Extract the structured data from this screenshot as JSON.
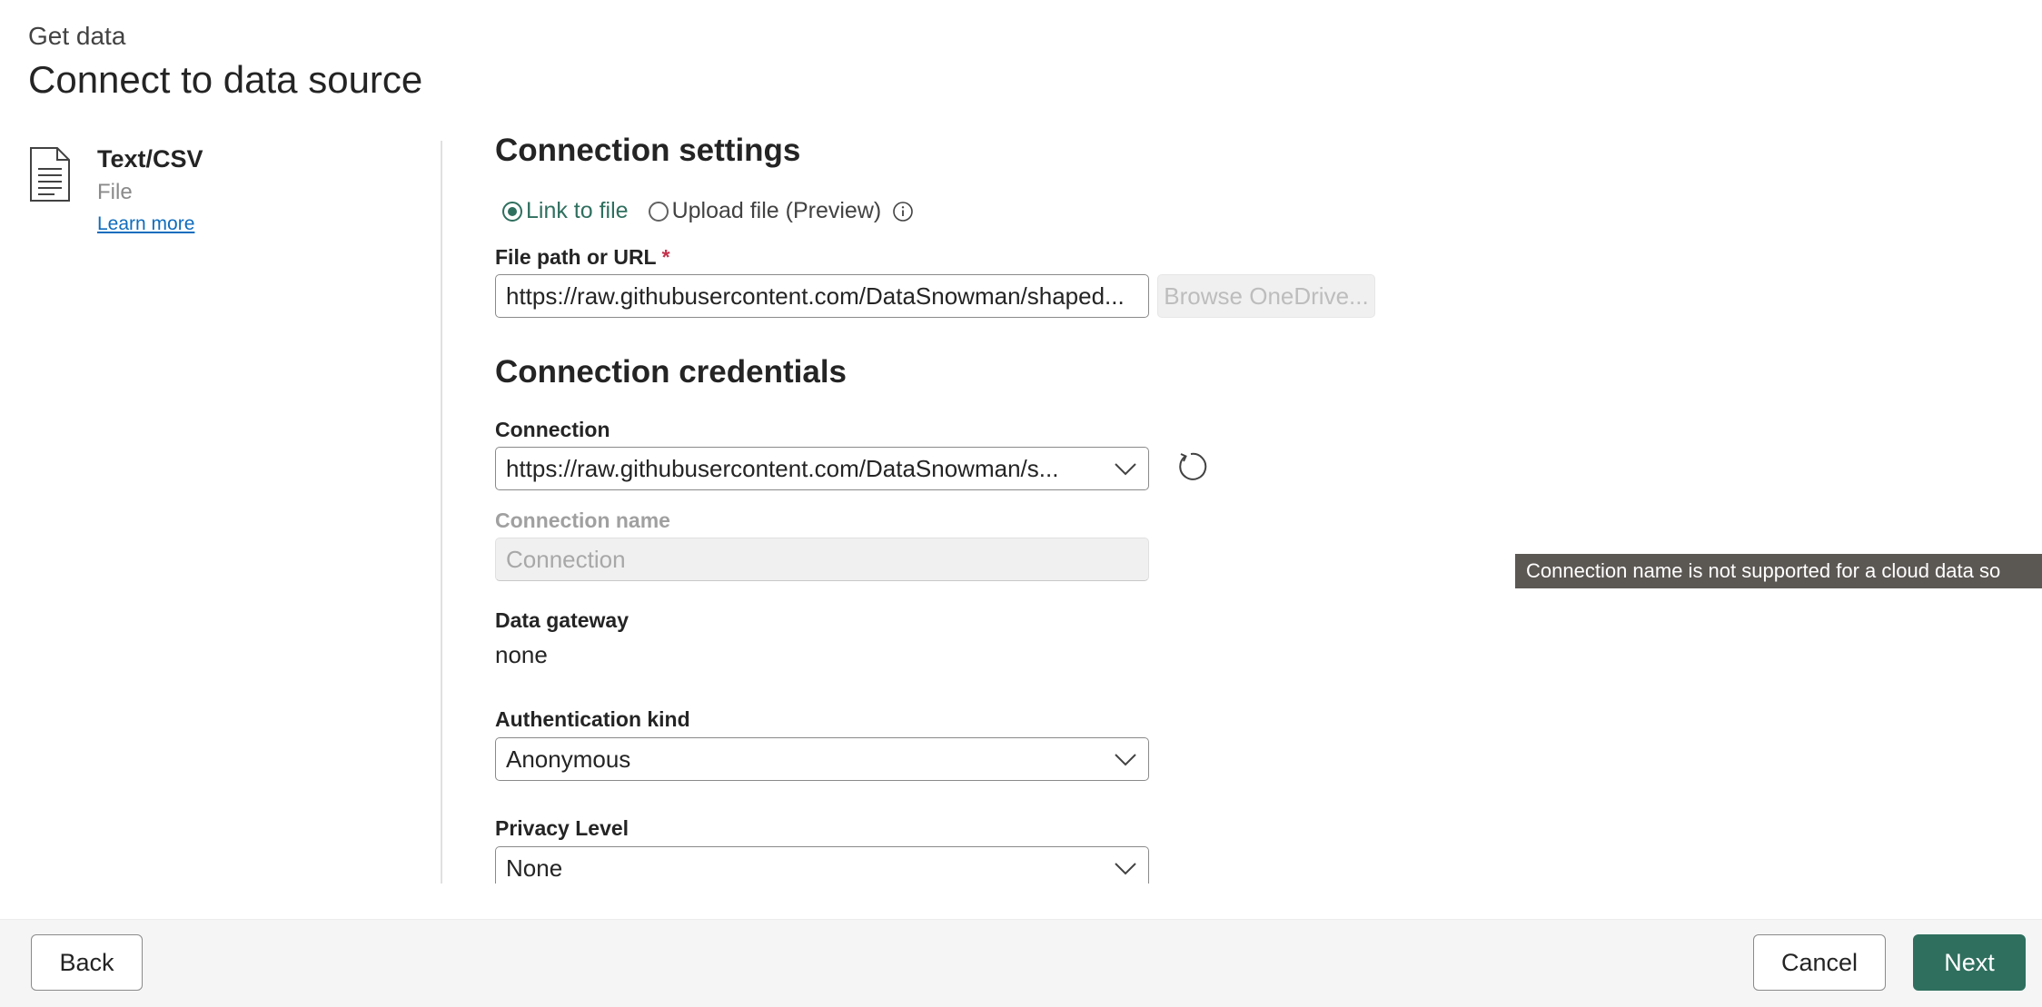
{
  "header": {
    "subtitle": "Get data",
    "title": "Connect to data source"
  },
  "connector": {
    "icon": "document-icon",
    "name": "Text/CSV",
    "kind": "File",
    "learn_more": "Learn more"
  },
  "connection_settings": {
    "title": "Connection settings",
    "radio_options": [
      {
        "label": "Link to file",
        "selected": true
      },
      {
        "label": "Upload file (Preview)",
        "selected": false
      }
    ],
    "file_path_label": "File path or URL",
    "required_marker": "*",
    "file_path_value": "https://raw.githubusercontent.com/DataSnowman/shaped...",
    "browse_button": "Browse OneDrive..."
  },
  "connection_credentials": {
    "title": "Connection credentials",
    "connection_label": "Connection",
    "connection_value": "https://raw.githubusercontent.com/DataSnowman/s...",
    "connection_name_label": "Connection name",
    "connection_name_placeholder": "Connection",
    "data_gateway_label": "Data gateway",
    "data_gateway_value": "none",
    "auth_kind_label": "Authentication kind",
    "auth_kind_value": "Anonymous",
    "privacy_level_label": "Privacy Level",
    "privacy_level_value": "None"
  },
  "tooltip": {
    "text": "Connection name is not supported for a cloud data so"
  },
  "footer": {
    "back": "Back",
    "cancel": "Cancel",
    "next": "Next"
  },
  "colors": {
    "accent": "#2f6f5e",
    "link": "#0f6cbd",
    "required": "#c4314b",
    "tooltip_bg": "#5b5753"
  }
}
